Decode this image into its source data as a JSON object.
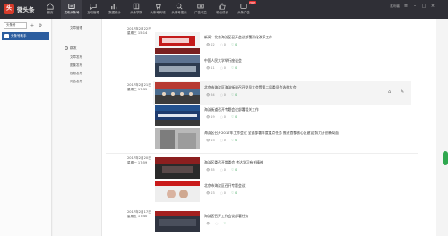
{
  "app": {
    "logo_mark": "头",
    "logo_text": "微头条"
  },
  "nav": [
    {
      "label": "首页",
      "icon": "home-icon"
    },
    {
      "label": "发布头条号",
      "icon": "publish-icon",
      "active": true
    },
    {
      "label": "互动管理",
      "icon": "comment-icon"
    },
    {
      "label": "数据统计",
      "icon": "chart-icon"
    },
    {
      "label": "头条学院",
      "icon": "book-icon"
    },
    {
      "label": "头条号商城",
      "icon": "cart-icon"
    },
    {
      "label": "头条号搜索",
      "icon": "search-icon"
    },
    {
      "label": "广告收益",
      "icon": "money-icon"
    },
    {
      "label": "粉丝成长",
      "icon": "like-icon"
    },
    {
      "label": "头条广告",
      "icon": "ad-icon",
      "badge": "HOT"
    }
  ],
  "top_right": {
    "user": "胜利者"
  },
  "sidebar1": {
    "select": "头条号",
    "account": "头条号助手"
  },
  "sidebar2": {
    "links": [
      "文章管理"
    ],
    "section": "群发",
    "sub": [
      "文章发布",
      "图集发布",
      "视频发布",
      "问答发布"
    ]
  },
  "groups": [
    {
      "date": "2017年2月22日",
      "time": "星期三 15:14",
      "articles": [
        {
          "title": "新闻：北京海淀区召开会议部署深化改革工作",
          "views": "22",
          "comments": "0",
          "likes": "0"
        },
        {
          "title": "中国人民大学举行座谈会",
          "views": "11",
          "comments": "0",
          "likes": "0"
        }
      ]
    },
    {
      "date": "2017年2月21日",
      "time": "星期二 17:35",
      "articles": [
        {
          "title": "北京市海淀区海淀街道召开党员大会暨第二届委员会选举大会",
          "views": "54",
          "comments": "0",
          "likes": "0"
        },
        {
          "title": "海淀街道召开专题会议部署相关工作",
          "views": "19",
          "comments": "0",
          "likes": "0"
        },
        {
          "title": "海淀区召开2017年工作会议 全面部署年度重点任务 推进首都核心区建设 努力开创新局面",
          "views": "23",
          "comments": "0",
          "likes": "0"
        }
      ]
    },
    {
      "date": "2017年2月20日",
      "time": "星期一 17:59",
      "articles": [
        {
          "title": "海淀区委召开常委会 传达学习有关精神",
          "views": "35",
          "comments": "0",
          "likes": "0"
        },
        {
          "title": "北京市海淀区召开专题会议",
          "views": "23",
          "comments": "0",
          "likes": "0"
        }
      ]
    },
    {
      "date": "2017年2月17日",
      "time": "星期五 17:40",
      "articles": [
        {
          "title": "海淀区召开工作会议部署任务",
          "views": "",
          "comments": "",
          "likes": ""
        }
      ]
    }
  ],
  "colors": {
    "topbar": "#2f2f36",
    "account": "#2b5d9f",
    "accent_green": "#2fa84f"
  }
}
